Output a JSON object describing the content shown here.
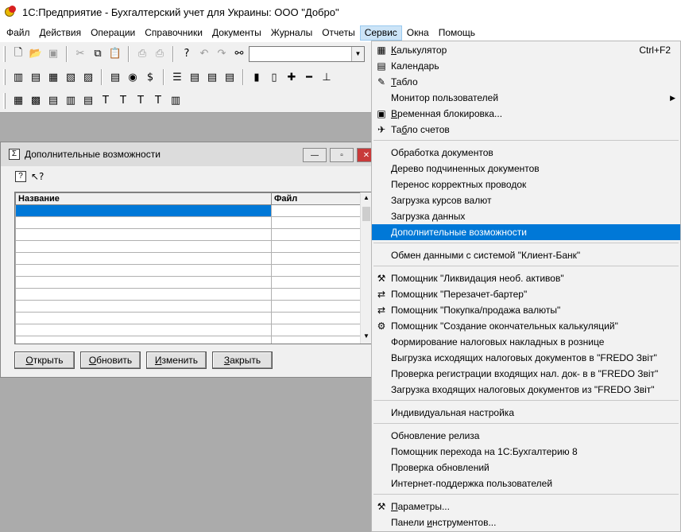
{
  "window": {
    "title": "1С:Предприятие - Бухгалтерский учет для Украины: ООО \"Добро\""
  },
  "menubar": [
    "Файл",
    "Действия",
    "Операции",
    "Справочники",
    "Документы",
    "Журналы",
    "Отчеты",
    "Сервис",
    "Окна",
    "Помощь"
  ],
  "menubar_active": "Сервис",
  "toolbar": {
    "search_value": ""
  },
  "child_window": {
    "title": "Дополнительные возможности",
    "columns": [
      "Название",
      "Файл"
    ],
    "row_count": 12,
    "buttons": {
      "open": {
        "u": "О",
        "rest": "ткрыть"
      },
      "refresh": {
        "u": "О",
        "rest": "бновить"
      },
      "edit": {
        "u": "И",
        "rest": "зменить"
      },
      "close": {
        "u": "З",
        "rest": "акрыть"
      }
    }
  },
  "service_menu": {
    "calculator": {
      "u": "К",
      "rest": "алькулятор",
      "shortcut": "Ctrl+F2"
    },
    "calendar": {
      "pre": "Кален",
      "u": "д",
      "rest": "арь"
    },
    "tablo": {
      "u": "Т",
      "rest": "абло"
    },
    "users_monitor": "Монитор пользователей",
    "temp_lock": {
      "u": "В",
      "rest": "ременная блокировка..."
    },
    "accounts_table": {
      "pre": "Та",
      "u": "б",
      "rest": "ло счетов"
    },
    "doc_processing": "Обработка документов",
    "subordinate_tree": "Дерево подчиненных документов",
    "transfer_corrections": "Перенос корректных проводок",
    "load_rates": "Загрузка курсов валют",
    "load_data": "Загрузка данных",
    "extra_features": "Дополнительные возможности",
    "client_bank": "Обмен данными с системой \"Клиент-Банк\"",
    "wizard_liquidation": "Помощник \"Ликвидация необ. активов\"",
    "wizard_barter": "Помощник \"Перезачет-бартер\"",
    "wizard_currency": "Помощник \"Покупка/продажа валюты\"",
    "wizard_calc": "Помощник \"Создание окончательных калькуляций\"",
    "retail_invoices": "Формирование налоговых накладных в рознице",
    "fredo_out": "Выгрузка исходящих налоговых документов в \"FREDO Звіт\"",
    "fredo_check": "Проверка регистрации входящих нал. док- в в \"FREDO Звіт\"",
    "fredo_in": "Загрузка входящих налоговых документов из \"FREDO Звіт\"",
    "individual": "Индивидуальная настройка",
    "release_update": "Обновление релиза",
    "wizard_migrate": "Помощник перехода на 1С:Бухгалтерию 8",
    "check_updates": "Проверка обновлений",
    "internet_support": "Интернет-поддержка пользователей",
    "params": {
      "u": "П",
      "rest": "араметры..."
    },
    "toolbars": {
      "pre": "Панели ",
      "u": "и",
      "rest": "нструментов..."
    }
  }
}
